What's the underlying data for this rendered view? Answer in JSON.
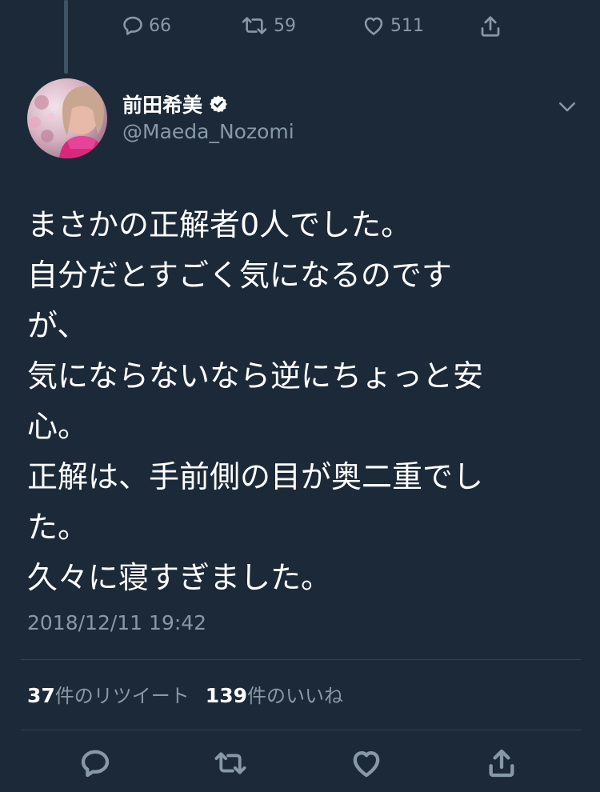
{
  "previous_tweet": {
    "replies": "66",
    "retweets": "59",
    "likes": "511"
  },
  "author": {
    "display_name": "前田希美",
    "handle": "@Maeda_Nozomi",
    "verified": true
  },
  "tweet": {
    "lines": [
      "まさかの正解者0人でした。",
      "自分だとすごく気になるのです",
      "が、",
      "気にならないなら逆にちょっと安",
      "心。",
      "正解は、手前側の目が奥二重でし",
      "た。",
      "久々に寝すぎました。"
    ],
    "timestamp": "2018/12/11 19:42"
  },
  "stats": {
    "retweet_count": "37",
    "retweet_label": "件のリツイート",
    "like_count": "139",
    "like_label": "件のいいね"
  },
  "icons": {
    "reply": "reply-icon",
    "retweet": "retweet-icon",
    "like": "heart-icon",
    "share": "share-icon",
    "more": "chevron-down-icon",
    "verified": "verified-badge-icon"
  },
  "colors": {
    "background": "#1c2938",
    "secondary_text": "#8899a6",
    "divider": "#38444d",
    "verified": "#ffffff"
  }
}
